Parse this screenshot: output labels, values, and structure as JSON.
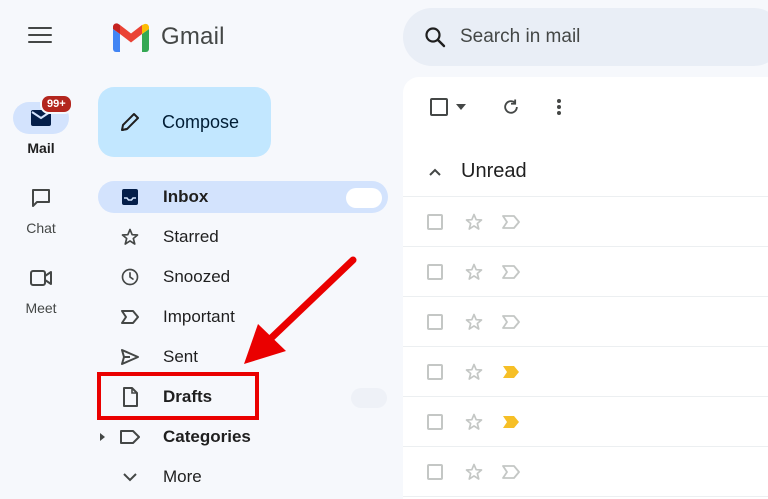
{
  "rail": {
    "items": [
      {
        "label": "Mail",
        "icon": "mail-icon",
        "badge": "99+",
        "active": true
      },
      {
        "label": "Chat",
        "icon": "chat-icon",
        "active": false
      },
      {
        "label": "Meet",
        "icon": "meet-icon",
        "active": false
      }
    ]
  },
  "app": {
    "logo_text": "Gmail"
  },
  "search": {
    "placeholder": "Search in mail"
  },
  "compose": {
    "label": "Compose"
  },
  "nav": {
    "items": [
      {
        "label": "Inbox",
        "icon": "inbox-icon"
      },
      {
        "label": "Starred",
        "icon": "star-icon"
      },
      {
        "label": "Snoozed",
        "icon": "clock-icon"
      },
      {
        "label": "Important",
        "icon": "important-icon"
      },
      {
        "label": "Sent",
        "icon": "send-icon"
      },
      {
        "label": "Drafts",
        "icon": "draft-icon"
      },
      {
        "label": "Categories",
        "icon": "label-icon"
      },
      {
        "label": "More",
        "icon": "chevron-down-icon"
      }
    ]
  },
  "main": {
    "section_title": "Unread",
    "rows": [
      {
        "important": false
      },
      {
        "important": false
      },
      {
        "important": false
      },
      {
        "important": true
      },
      {
        "important": true
      },
      {
        "important": false
      }
    ]
  },
  "colors": {
    "background": "#f6f8fc",
    "active_nav": "#d3e3fd",
    "compose": "#c2e7ff",
    "annotation": "#ea0000",
    "important_marker": "#f6bf26",
    "badge": "#b3261e"
  }
}
